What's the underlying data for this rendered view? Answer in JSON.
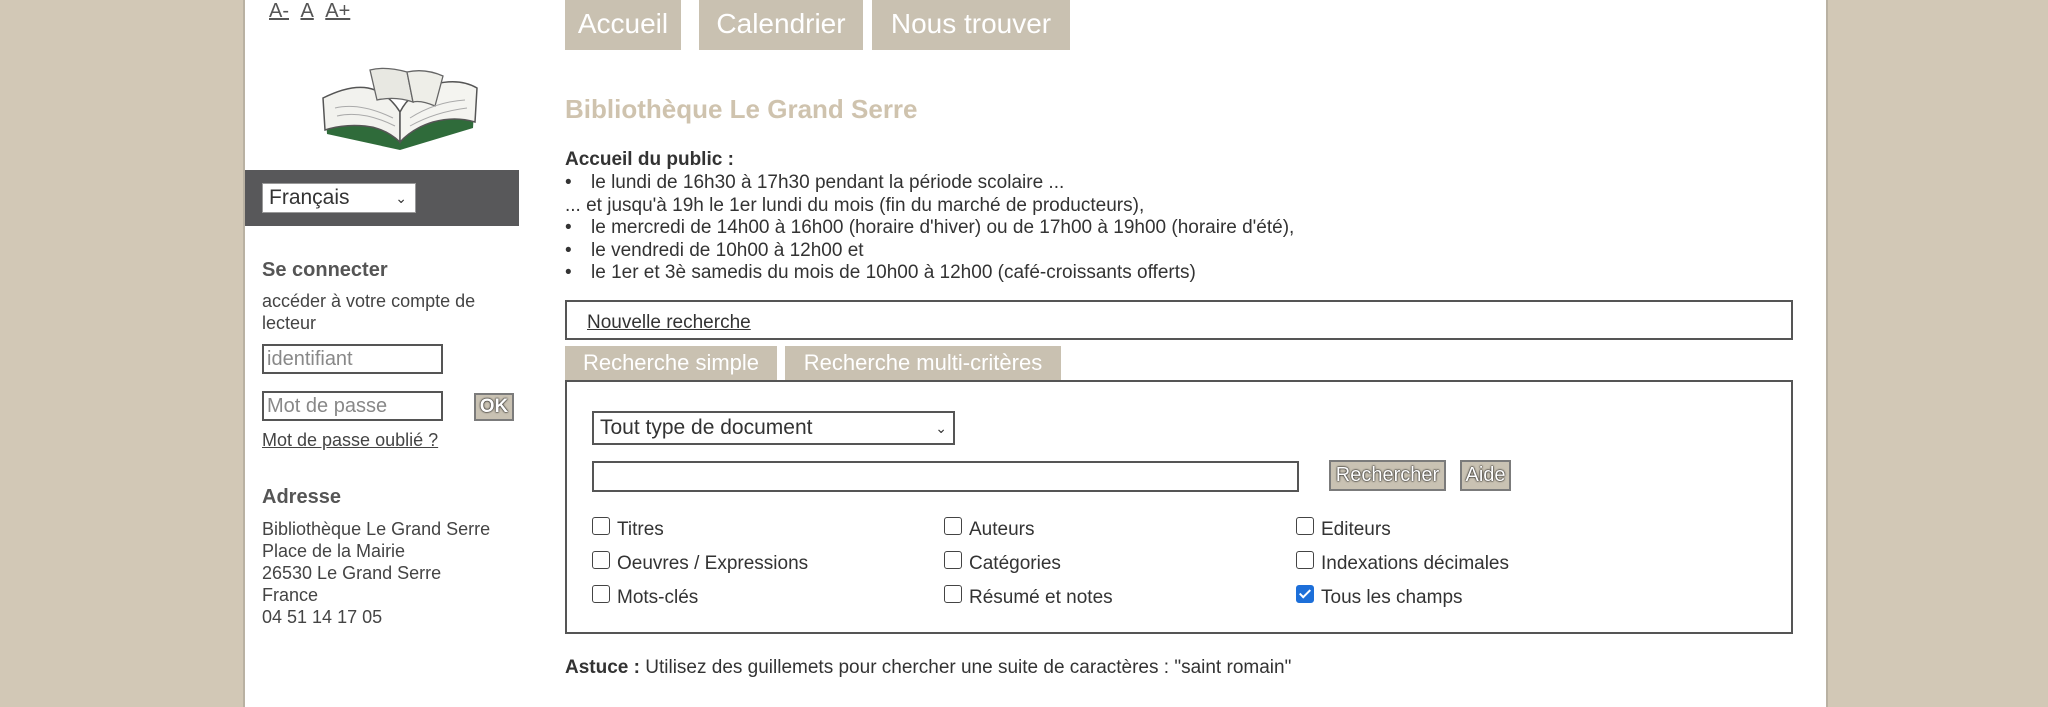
{
  "font_size_controls": [
    "A-",
    "A",
    "A+"
  ],
  "language": {
    "selected": "Français"
  },
  "login": {
    "heading": "Se connecter",
    "subtitle": "accéder à votre compte de lecteur",
    "username_placeholder": "identifiant",
    "password_placeholder": "Mot de passe",
    "ok_label": "OK",
    "forgot_label": "Mot de passe oublié ?"
  },
  "address": {
    "heading": "Adresse",
    "lines": [
      "Bibliothèque Le Grand Serre",
      "Place de la Mairie",
      "26530 Le Grand Serre",
      "France",
      "04 51 14 17 05"
    ]
  },
  "nav": {
    "tabs": [
      "Accueil",
      "Calendrier",
      "Nous trouver"
    ]
  },
  "library_title": "Bibliothèque Le Grand Serre",
  "hours": {
    "heading": "Accueil du public :",
    "lines": [
      "le lundi de 16h30 à 17h30 pendant la période scolaire ...",
      "... et jusqu'à 19h le 1er lundi du mois (fin du marché de producteurs),",
      "le mercredi de 14h00 à 16h00 (horaire d'hiver) ou de 17h00 à 19h00 (horaire d'été),",
      "le vendredi de 10h00 à 12h00 et",
      "le 1er et 3è samedis du mois de 10h00 à 12h00 (café-croissants offerts)"
    ]
  },
  "search": {
    "new_search_label": "Nouvelle recherche",
    "tabs": [
      "Recherche simple",
      "Recherche multi-critères"
    ],
    "doc_type_selected": "Tout type de document",
    "query_value": "",
    "search_button": "Rechercher",
    "help_button": "Aide",
    "fields": [
      {
        "label": "Titres",
        "checked": false
      },
      {
        "label": "Auteurs",
        "checked": false
      },
      {
        "label": "Editeurs",
        "checked": false
      },
      {
        "label": "Oeuvres / Expressions",
        "checked": false
      },
      {
        "label": "Catégories",
        "checked": false
      },
      {
        "label": "Indexations décimales",
        "checked": false
      },
      {
        "label": "Mots-clés",
        "checked": false
      },
      {
        "label": "Résumé et notes",
        "checked": false
      },
      {
        "label": "Tous les champs",
        "checked": true
      }
    ]
  },
  "tip": {
    "label": "Astuce :",
    "text": "Utilisez des guillemets pour chercher une suite de caractères : \"saint romain\""
  },
  "colors": {
    "background": "#d2c8b6",
    "tab": "#c9c1b1",
    "title": "#cfc3ae",
    "language_bar": "#58585a",
    "checkbox_checked": "#1d6fd9"
  }
}
